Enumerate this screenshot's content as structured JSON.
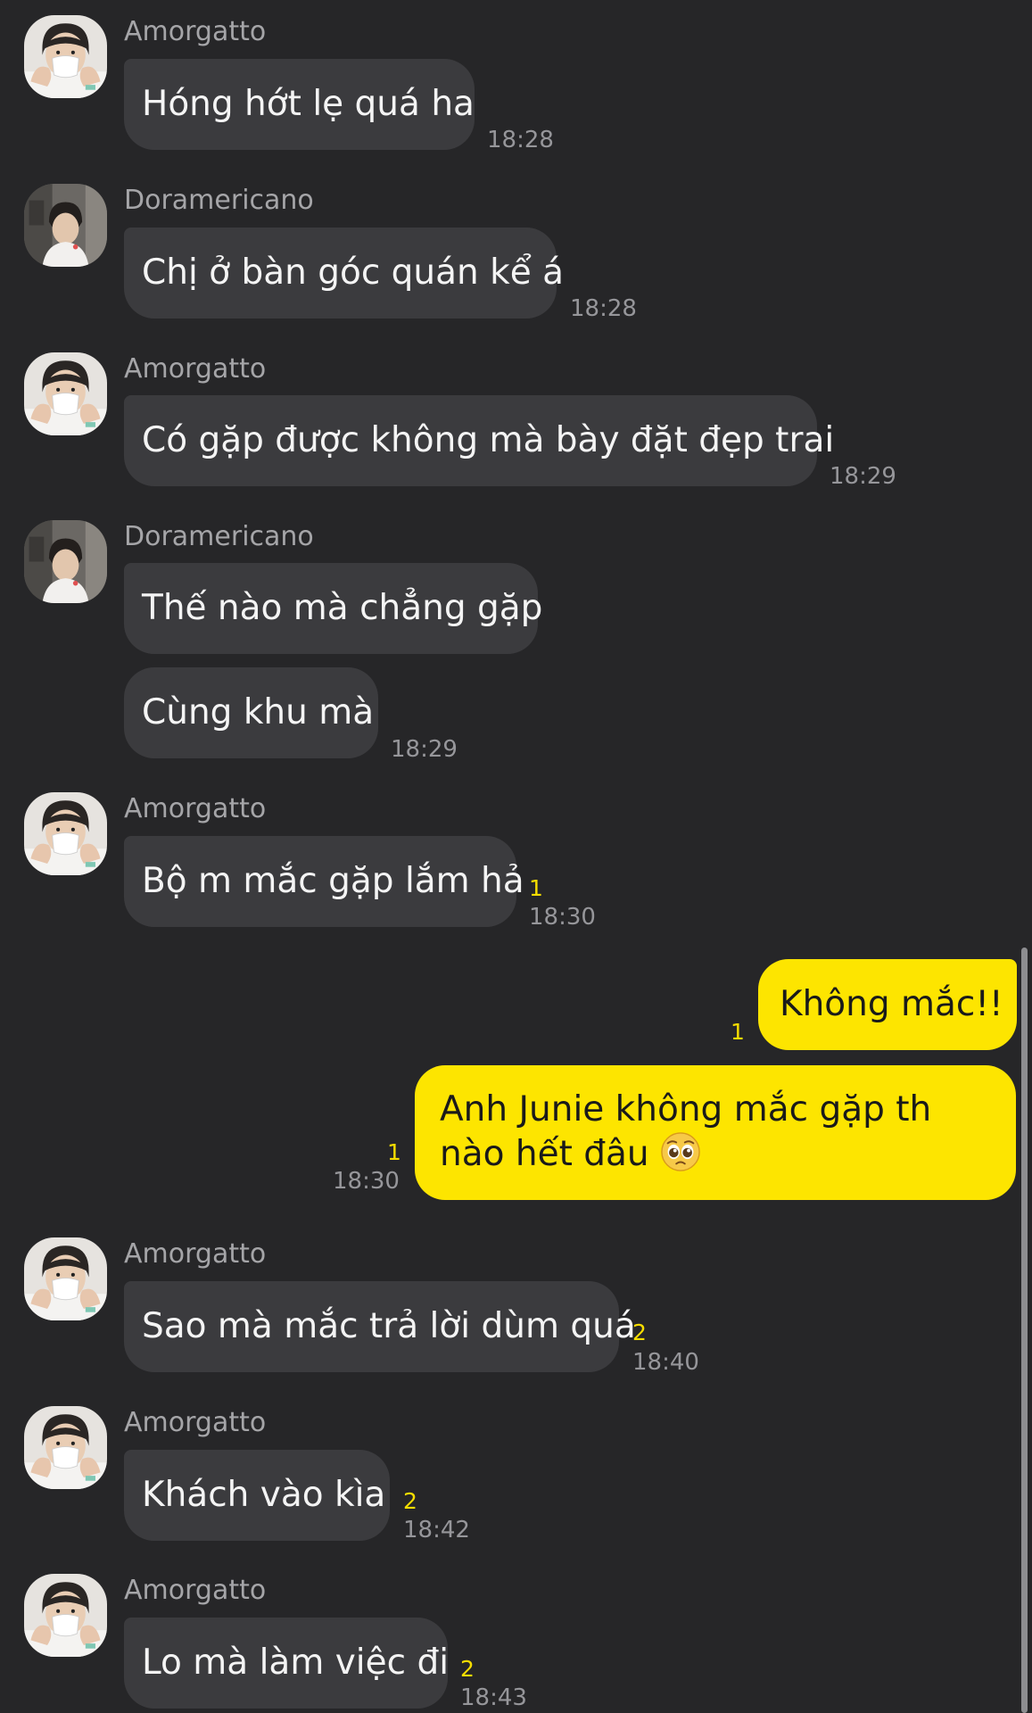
{
  "messages": [
    {
      "sender": "Amorgatto",
      "avatar": "avatar-amorgatto",
      "text": "Hóng hớt lẹ quá ha",
      "time": "18:28"
    },
    {
      "sender": "Doramericano",
      "avatar": "avatar-doramericano",
      "text": "Chị ở bàn góc quán kể á",
      "time": "18:28"
    },
    {
      "sender": "Amorgatto",
      "avatar": "avatar-amorgatto",
      "text": "Có gặp được không mà bày đặt đẹp trai",
      "time": "18:29"
    },
    {
      "sender": "Doramericano",
      "avatar": "avatar-doramericano",
      "text_1": "Thế nào mà chẳng gặp",
      "text_2": "Cùng khu mà",
      "time": "18:29"
    },
    {
      "sender": "Amorgatto",
      "avatar": "avatar-amorgatto",
      "text": "Bộ m mắc gặp lắm hả",
      "unread": "1",
      "time": "18:30"
    },
    {
      "outgoing": true,
      "text": "Không mắc!!",
      "unread": "1"
    },
    {
      "outgoing": true,
      "text": "Anh Junie không mắc gặp th nào hết đâu",
      "emoji": "pleading-face-icon",
      "unread": "1",
      "time": "18:30"
    },
    {
      "sender": "Amorgatto",
      "avatar": "avatar-amorgatto",
      "text": "Sao mà mắc trả lời dùm quá",
      "unread": "2",
      "time": "18:40"
    },
    {
      "sender": "Amorgatto",
      "avatar": "avatar-amorgatto",
      "text": "Khách vào kìa",
      "unread": "2",
      "time": "18:42"
    },
    {
      "sender": "Amorgatto",
      "avatar": "avatar-amorgatto",
      "text": "Lo mà làm việc đi",
      "unread": "2",
      "time": "18:43"
    }
  ],
  "colors": {
    "background": "#262628",
    "incoming_bubble": "#3b3b3e",
    "outgoing_bubble": "#fde500",
    "unread_count": "#f6dd00",
    "sender_name": "#a5a5a8",
    "timestamp": "#96969a"
  }
}
